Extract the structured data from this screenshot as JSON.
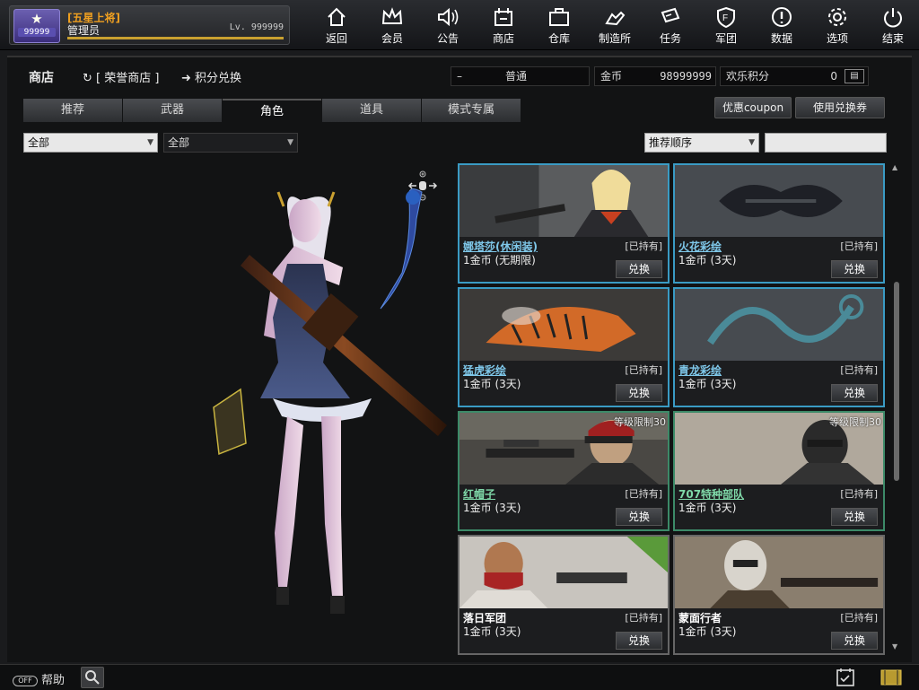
{
  "profile": {
    "rank": "[五星上将]",
    "name": "管理员",
    "level": "Lv. 999999",
    "badge_number": "99999",
    "xp_progress": 1.0
  },
  "nav": [
    {
      "label": "返回",
      "icon": "home-icon"
    },
    {
      "label": "会员",
      "icon": "crown-icon"
    },
    {
      "label": "公告",
      "icon": "speaker-icon"
    },
    {
      "label": "商店",
      "icon": "shop-icon"
    },
    {
      "label": "仓库",
      "icon": "briefcase-icon"
    },
    {
      "label": "制造所",
      "icon": "factory-icon"
    },
    {
      "label": "任务",
      "icon": "mission-icon"
    },
    {
      "label": "军团",
      "icon": "shield-icon"
    },
    {
      "label": "数据",
      "icon": "alert-icon"
    },
    {
      "label": "选项",
      "icon": "gear-icon"
    },
    {
      "label": "结束",
      "icon": "power-icon"
    }
  ],
  "header": {
    "title": "商店",
    "honor_shop": "[ 荣誉商店 ]",
    "points_exchange": "积分兑换",
    "mode_minus": "–",
    "mode_value": "普通",
    "gold_label": "金币",
    "gold_value": "98999999",
    "fun_label": "欢乐积分",
    "fun_value": "0"
  },
  "tabs": [
    "推荐",
    "武器",
    "角色",
    "道具",
    "模式专属"
  ],
  "active_tab": "角色",
  "buttons": {
    "coupon": "优惠coupon",
    "use_voucher": "使用兑换券"
  },
  "filters": {
    "filter1": "全部",
    "filter2": "全部",
    "sort": "推荐顺序",
    "search_value": ""
  },
  "items": [
    {
      "name": "娜塔莎(休闲装)",
      "owned": "[已持有]",
      "price": "1金币 (无期限)",
      "buy": "兑换",
      "limit": "",
      "style": "blue",
      "art": "natasha"
    },
    {
      "name": "火花彩绘",
      "owned": "[已持有]",
      "price": "1金币 (3天)",
      "buy": "兑换",
      "limit": "",
      "style": "blue",
      "art": "spark"
    },
    {
      "name": "猛虎彩绘",
      "owned": "[已持有]",
      "price": "1金币 (3天)",
      "buy": "兑换",
      "limit": "",
      "style": "blue",
      "art": "tiger"
    },
    {
      "name": "青龙彩绘",
      "owned": "[已持有]",
      "price": "1金币 (3天)",
      "buy": "兑换",
      "limit": "",
      "style": "blue",
      "art": "dragon"
    },
    {
      "name": "红帽子",
      "owned": "[已持有]",
      "price": "1金币 (3天)",
      "buy": "兑换",
      "limit": "等级限制30",
      "style": "green",
      "art": "redhat"
    },
    {
      "name": "707特种部队",
      "owned": "[已持有]",
      "price": "1金币 (3天)",
      "buy": "兑换",
      "limit": "等级限制30",
      "style": "green",
      "art": "707"
    },
    {
      "name": "落日军团",
      "owned": "[已持有]",
      "price": "1金币 (3天)",
      "buy": "兑换",
      "limit": "",
      "style": "gray",
      "art": "sunset"
    },
    {
      "name": "蒙面行者",
      "owned": "[已持有]",
      "price": "1金币 (3天)",
      "buy": "兑换",
      "limit": "",
      "style": "gray",
      "art": "masked"
    }
  ],
  "bottom": {
    "help_label": "帮助",
    "help_badge": "OFF"
  }
}
